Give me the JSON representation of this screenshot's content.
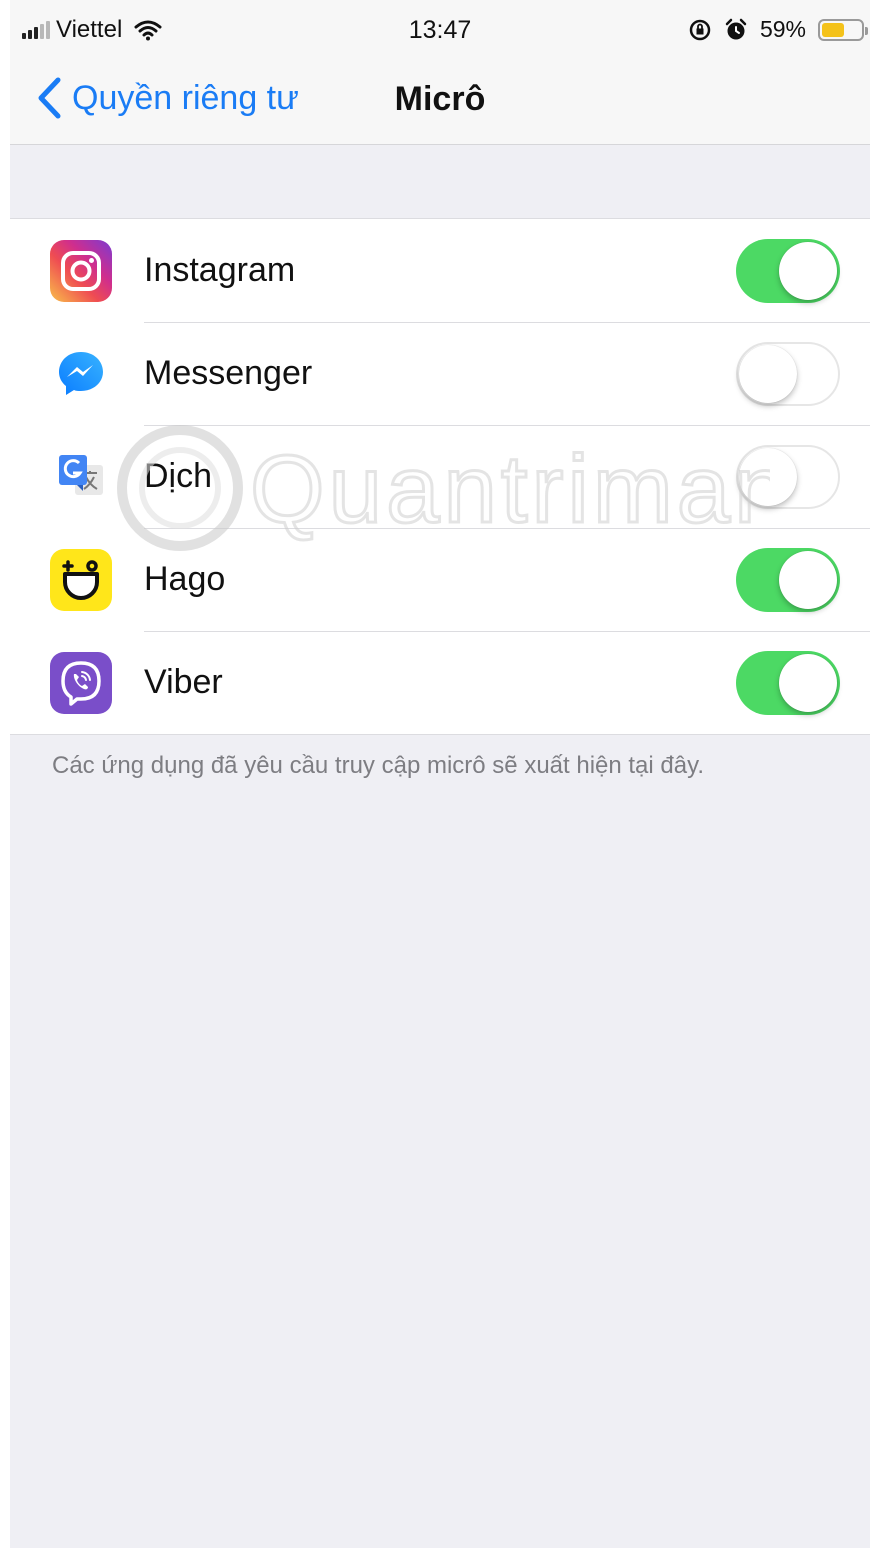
{
  "status_bar": {
    "carrier": "Viettel",
    "time": "13:47",
    "battery_percent": "59%",
    "battery_level": 0.59,
    "icons": [
      "signal-icon",
      "wifi-icon",
      "screen-lock-icon",
      "alarm-icon",
      "battery-icon"
    ]
  },
  "nav": {
    "back_label": "Quyền riêng tư",
    "title": "Micrô"
  },
  "apps": [
    {
      "name": "Instagram",
      "enabled": true,
      "icon": "instagram-icon"
    },
    {
      "name": "Messenger",
      "enabled": false,
      "icon": "messenger-icon"
    },
    {
      "name": "Dịch",
      "enabled": false,
      "icon": "google-translate-icon"
    },
    {
      "name": "Hago",
      "enabled": true,
      "icon": "hago-icon"
    },
    {
      "name": "Viber",
      "enabled": true,
      "icon": "viber-icon"
    }
  ],
  "footer_note": "Các ứng dụng đã yêu cầu truy cập micrô sẽ xuất hiện tại đây.",
  "watermark": "Quantrimang",
  "colors": {
    "accent": "#1a7cf5",
    "toggle_on": "#4cd964",
    "background": "#efeff4"
  }
}
